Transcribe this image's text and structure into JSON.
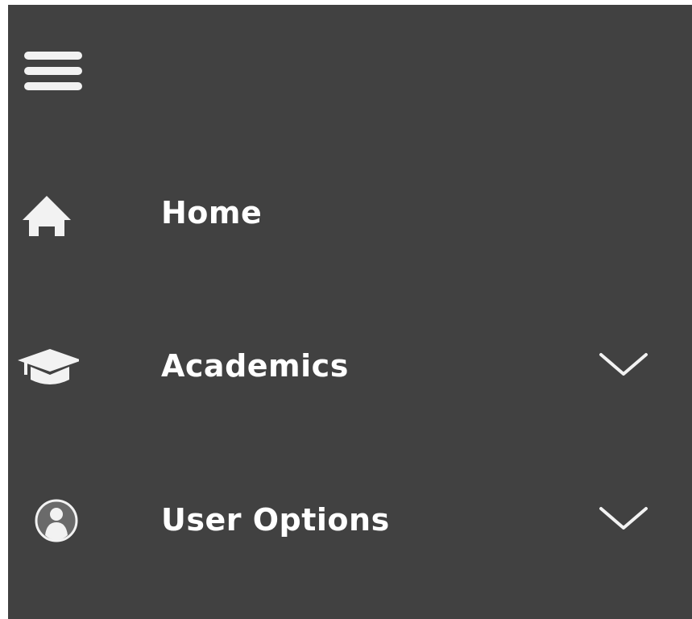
{
  "nav": {
    "menu_icon": "hamburger-menu-icon",
    "items": [
      {
        "label": "Home",
        "icon": "home-icon",
        "expandable": false
      },
      {
        "label": "Academics",
        "icon": "graduation-cap-icon",
        "expandable": true
      },
      {
        "label": "User Options",
        "icon": "user-circle-icon",
        "expandable": true
      }
    ]
  },
  "colors": {
    "sidebar_bg": "#414141",
    "text": "#ffffff",
    "icon": "#f2f2f2"
  }
}
